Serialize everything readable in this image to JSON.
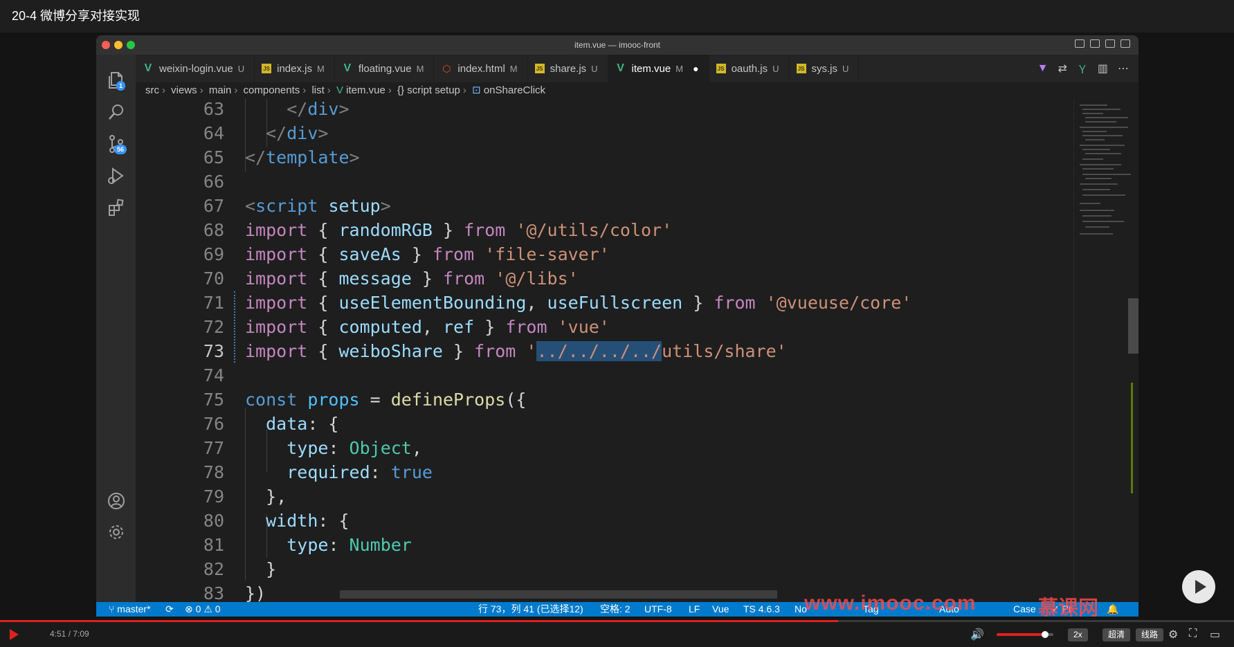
{
  "video": {
    "title": "20-4 微博分享对接实现",
    "time": "4:51 / 7:09",
    "progress_fraction": 0.679,
    "volume_fraction": 0.85,
    "speed_label": "2x",
    "quality_label": "超清",
    "route_label": "线路",
    "watermark": "www.imooc.com",
    "watermark_brand": "慕课网"
  },
  "window": {
    "title": "item.vue — imooc-front"
  },
  "activity": {
    "explorer_badge": "1",
    "scm_badge": "56"
  },
  "tabs": [
    {
      "label": "weixin-login.vue",
      "status": "U",
      "kind": "vue"
    },
    {
      "label": "index.js",
      "status": "M",
      "kind": "js"
    },
    {
      "label": "floating.vue",
      "status": "M",
      "kind": "vue"
    },
    {
      "label": "index.html",
      "status": "M",
      "kind": "html"
    },
    {
      "label": "share.js",
      "status": "U",
      "kind": "js"
    },
    {
      "label": "item.vue",
      "status": "M",
      "kind": "vue",
      "active": true
    },
    {
      "label": "oauth.js",
      "status": "U",
      "kind": "js"
    },
    {
      "label": "sys.js",
      "status": "U",
      "kind": "js"
    }
  ],
  "breadcrumb": [
    "src",
    "views",
    "main",
    "components",
    "list",
    "item.vue",
    "{} script setup",
    "onShareClick"
  ],
  "editor": {
    "line_numbers": [
      "63",
      "64",
      "65",
      "66",
      "67",
      "68",
      "69",
      "70",
      "71",
      "72",
      "73",
      "74",
      "75",
      "76",
      "77",
      "78",
      "79",
      "80",
      "81",
      "82",
      "83"
    ],
    "current_line": "73"
  },
  "status": {
    "branch": "master*",
    "problems_errors": "0",
    "problems_warnings": "0",
    "position": "行 73，列 41 (已选择12)",
    "indent": "空格: 2",
    "encoding": "UTF-8",
    "eol": "LF",
    "language": "Vue",
    "ts_version": "TS 4.6.3",
    "extra1": "No",
    "extra2": "Tag",
    "extra3": "Auto",
    "extra4": "Case",
    "prettier": "Pr"
  }
}
